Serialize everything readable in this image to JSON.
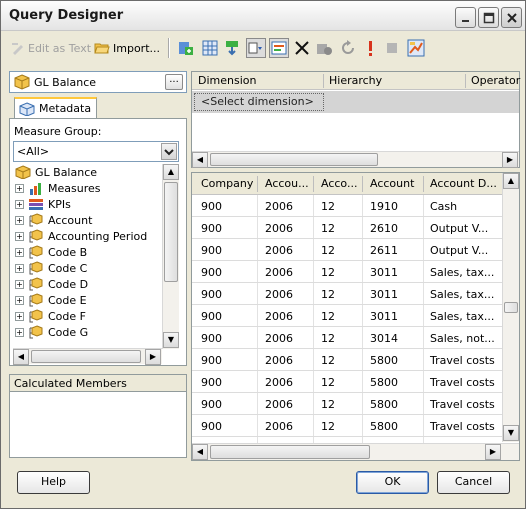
{
  "window": {
    "title": "Query Designer"
  },
  "toolbar": {
    "edit_as_text": "Edit as Text",
    "import": "Import..."
  },
  "left": {
    "cube_name": "GL Balance",
    "cube_button": "...",
    "tab_label": "Metadata",
    "measure_group_label": "Measure Group:",
    "measure_group_value": "<All>",
    "tree": [
      {
        "label": "GL Balance",
        "icon": "cube-icon",
        "level": 0
      },
      {
        "label": "Measures",
        "icon": "measures-icon",
        "level": 1
      },
      {
        "label": "KPIs",
        "icon": "kpi-icon",
        "level": 1
      },
      {
        "label": "Account",
        "icon": "dimension-icon",
        "level": 1
      },
      {
        "label": "Accounting Period",
        "icon": "dimension-icon",
        "level": 1
      },
      {
        "label": "Code B",
        "icon": "dimension-icon",
        "level": 1
      },
      {
        "label": "Code C",
        "icon": "dimension-icon",
        "level": 1
      },
      {
        "label": "Code D",
        "icon": "dimension-icon",
        "level": 1
      },
      {
        "label": "Code E",
        "icon": "dimension-icon",
        "level": 1
      },
      {
        "label": "Code F",
        "icon": "dimension-icon",
        "level": 1
      },
      {
        "label": "Code G",
        "icon": "dimension-icon",
        "level": 1
      }
    ],
    "calculated_members": "Calculated Members"
  },
  "filter": {
    "columns": [
      "Dimension",
      "Hierarchy",
      "Operator"
    ],
    "placeholder_row": "<Select dimension>"
  },
  "results": {
    "columns": [
      "Company",
      "Accou...",
      "Acco...",
      "Account",
      "Account D..."
    ],
    "rows": [
      [
        "900",
        "2006",
        "12",
        "1910",
        "Cash"
      ],
      [
        "900",
        "2006",
        "12",
        "2610",
        "Output V..."
      ],
      [
        "900",
        "2006",
        "12",
        "2611",
        "Output V..."
      ],
      [
        "900",
        "2006",
        "12",
        "3011",
        "Sales, tax..."
      ],
      [
        "900",
        "2006",
        "12",
        "3011",
        "Sales, tax..."
      ],
      [
        "900",
        "2006",
        "12",
        "3011",
        "Sales, tax..."
      ],
      [
        "900",
        "2006",
        "12",
        "3014",
        "Sales, not..."
      ],
      [
        "900",
        "2006",
        "12",
        "5800",
        "Travel costs"
      ],
      [
        "900",
        "2006",
        "12",
        "5800",
        "Travel costs"
      ],
      [
        "900",
        "2006",
        "12",
        "5800",
        "Travel costs"
      ],
      [
        "900",
        "2006",
        "12",
        "5800",
        "Travel costs"
      ]
    ]
  },
  "buttons": {
    "help": "Help",
    "ok": "OK",
    "cancel": "Cancel"
  }
}
